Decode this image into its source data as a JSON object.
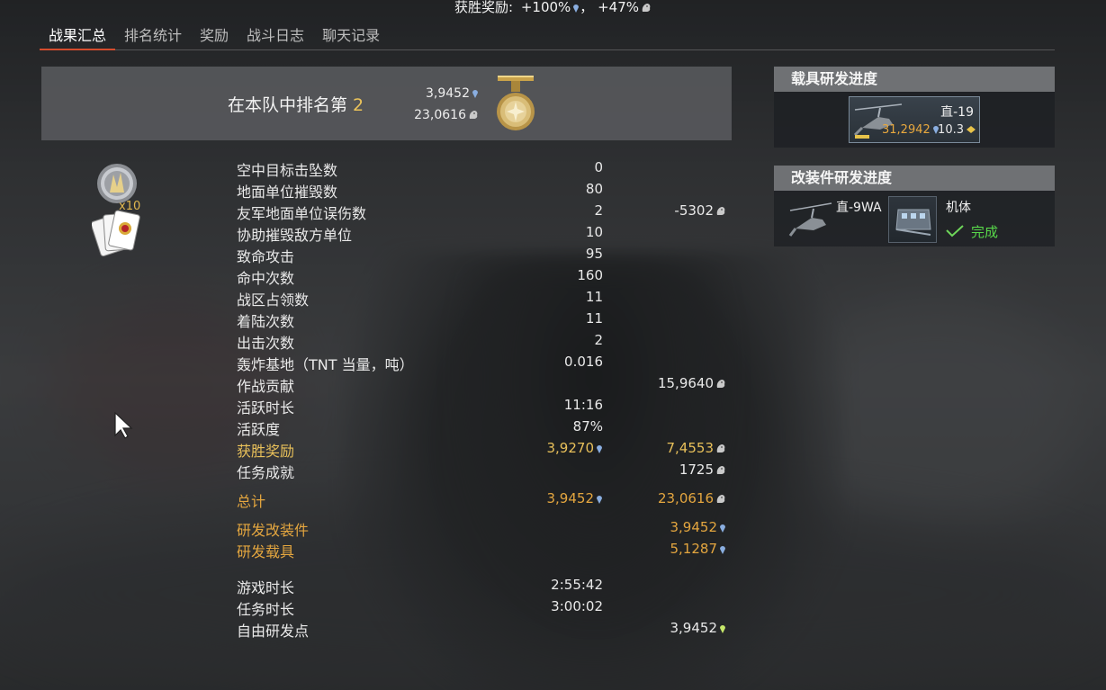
{
  "banner": {
    "label": "获胜奖励:",
    "rp_pct": "+100%",
    "sep": "，",
    "sl_pct": "+47%"
  },
  "tabs": [
    "战果汇总",
    "排名统计",
    "奖励",
    "战斗日志",
    "聊天记录"
  ],
  "rank": {
    "label": "在本队中排名第",
    "value": "2",
    "rp": "3,9452",
    "sl": "23,0616"
  },
  "award_count": "x10",
  "stats": [
    {
      "label": "空中目标击坠数",
      "v1": "0",
      "v2": ""
    },
    {
      "label": "地面单位摧毁数",
      "v1": "80",
      "v2": ""
    },
    {
      "label": "友军地面单位误伤数",
      "v1": "2",
      "v2": "-5302"
    },
    {
      "label": "协助摧毁敌方单位",
      "v1": "10",
      "v2": ""
    },
    {
      "label": "致命攻击",
      "v1": "95",
      "v2": ""
    },
    {
      "label": "命中次数",
      "v1": "160",
      "v2": ""
    },
    {
      "label": "战区占领数",
      "v1": "11",
      "v2": ""
    },
    {
      "label": "着陆次数",
      "v1": "11",
      "v2": ""
    },
    {
      "label": "出击次数",
      "v1": "2",
      "v2": ""
    },
    {
      "label": "轰炸基地（TNT 当量，吨）",
      "v1": "0.016",
      "v2": ""
    },
    {
      "label": "作战贡献",
      "v1": "",
      "v2": "15,9640"
    },
    {
      "label": "活跃时长",
      "v1": "11:16",
      "v2": ""
    },
    {
      "label": "活跃度",
      "v1": "87%",
      "v2": ""
    },
    {
      "label": "获胜奖励",
      "v1": "3,9270",
      "v2": "7,4553"
    },
    {
      "label": "任务成就",
      "v1": "",
      "v2": "1725"
    }
  ],
  "total": {
    "label": "总计",
    "rp": "3,9452",
    "sl": "23,0616"
  },
  "research": [
    {
      "label": "研发改装件",
      "value": "3,9452"
    },
    {
      "label": "研发载具",
      "value": "5,1287"
    }
  ],
  "times": [
    {
      "label": "游戏时长",
      "value": "2:55:42"
    },
    {
      "label": "任务时长",
      "value": "3:00:02"
    },
    {
      "label": "自由研发点",
      "value": "3,9452"
    }
  ],
  "vehicle_panel": {
    "title": "载具研发进度",
    "name": "直-19",
    "rp": "31,2942",
    "br": "10.3"
  },
  "mod_panel": {
    "title": "改装件研发进度",
    "vehicle": "直-9WA",
    "mod": "机体",
    "status": "完成"
  },
  "colors": {
    "rp_icon": "#8aaee0",
    "sl_icon": "#c9c9c9",
    "free_rp_icon": "#c6e86a",
    "yellow": "#e8c05a",
    "orange": "#e4a63f",
    "tab_accent": "#d54c2d"
  }
}
